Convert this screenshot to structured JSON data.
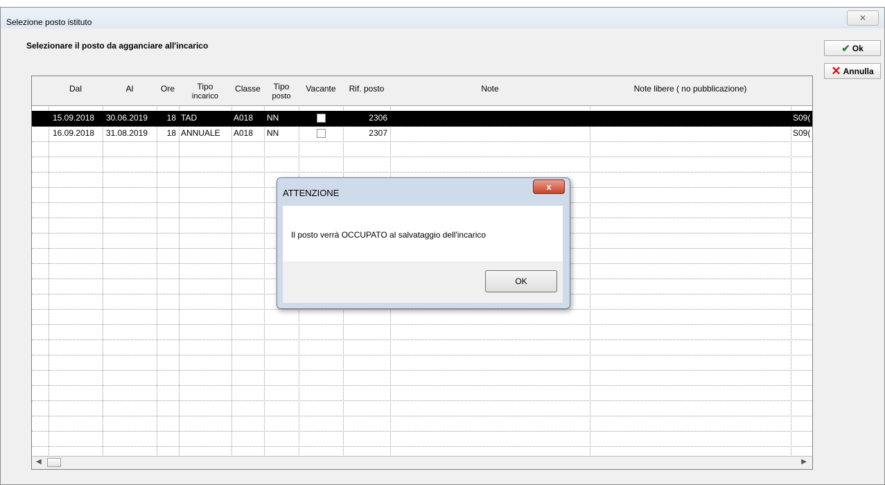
{
  "window": {
    "title": "Selezione posto istituto",
    "heading": "Selezionare il posto da agganciare all'incarico",
    "ok_label": "Ok",
    "cancel_label": "Annulla"
  },
  "grid": {
    "columns": [
      {
        "label": "Dal",
        "sub": ""
      },
      {
        "label": "Al",
        "sub": ""
      },
      {
        "label": "Ore",
        "sub": ""
      },
      {
        "label": "Tipo",
        "sub": "incarico"
      },
      {
        "label": "Classe",
        "sub": ""
      },
      {
        "label": "Tipo",
        "sub": "posto"
      },
      {
        "label": "Vacante",
        "sub": ""
      },
      {
        "label": "Rif. posto",
        "sub": ""
      },
      {
        "label": "Note",
        "sub": ""
      },
      {
        "label": "Note libere ( no pubblicazione)",
        "sub": ""
      },
      {
        "label": "",
        "sub": ""
      }
    ],
    "rows": [
      {
        "dal": "15.09.2018",
        "al": "30.06.2019",
        "ore": "18",
        "tipo_incarico": "TAD",
        "classe": "A018",
        "tipo_posto": "NN",
        "rif_posto": "2306",
        "extra": "S09(",
        "selected": true
      },
      {
        "dal": "16.09.2018",
        "al": "31.08.2019",
        "ore": "18",
        "tipo_incarico": "ANNUALE",
        "classe": "A018",
        "tipo_posto": "NN",
        "rif_posto": "2307",
        "extra": "S09(",
        "selected": false
      }
    ]
  },
  "dialog": {
    "title": "ATTENZIONE",
    "message": "Il posto verrà OCCUPATO al salvataggio dell'incarico",
    "ok_label": "OK"
  },
  "icons": {
    "ok": "checkmark-icon",
    "cancel": "x-icon",
    "close": "close-icon"
  },
  "colors": {
    "selected_row": "#000000",
    "dialog_close": "#c8442a"
  }
}
